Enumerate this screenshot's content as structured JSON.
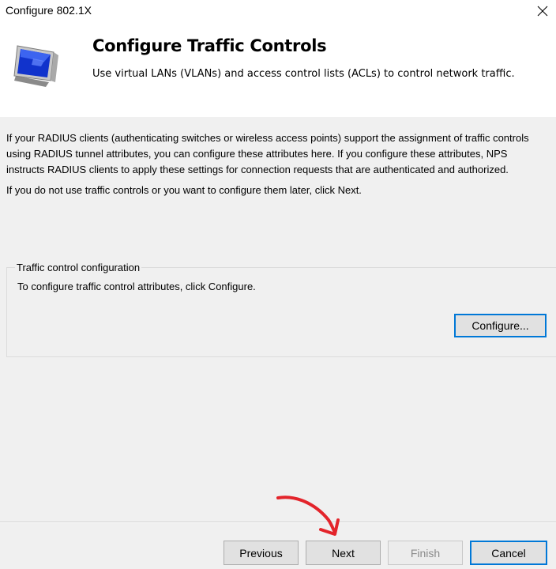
{
  "window": {
    "title": "Configure 802.1X"
  },
  "header": {
    "title": "Configure Traffic Controls",
    "subtitle": "Use virtual LANs (VLANs) and access control lists (ACLs) to control network traffic.",
    "icon": "monitor-icon"
  },
  "content": {
    "paragraph1": "If your RADIUS clients (authenticating switches or wireless access points) support the assignment of traffic controls\nusing RADIUS tunnel attributes, you can configure these attributes here. If you configure these attributes, NPS\ninstructs RADIUS clients to apply these settings for connection requests that are authenticated and authorized.",
    "paragraph2": "If you do not use traffic controls or you want to configure them later, click Next."
  },
  "group": {
    "label": "Traffic control configuration",
    "text": "To configure traffic control attributes, click Configure.",
    "configure_label": "Configure..."
  },
  "footer": {
    "previous_label": "Previous",
    "next_label": "Next",
    "finish_label": "Finish",
    "cancel_label": "Cancel"
  },
  "colors": {
    "accent": "#0078d7",
    "annotation": "#e3242b"
  }
}
